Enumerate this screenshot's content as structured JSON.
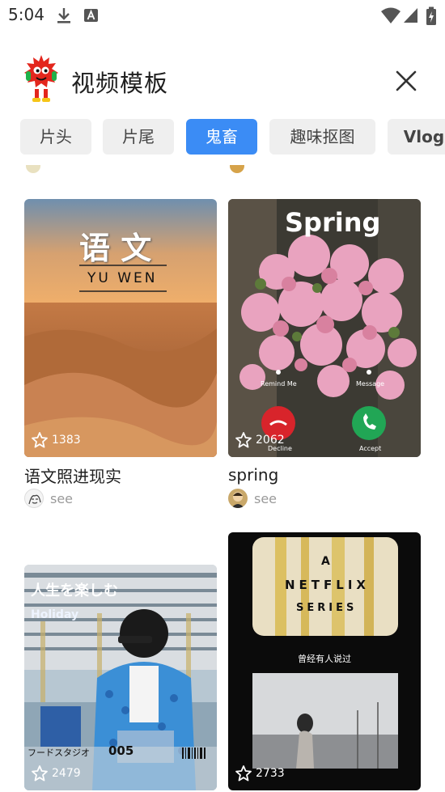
{
  "status_bar": {
    "time": "5:04",
    "icons": [
      "download-icon",
      "a-notification-icon",
      "wifi-icon",
      "signal-icon",
      "battery-charging-icon"
    ]
  },
  "header": {
    "title": "视频模板",
    "close_icon": "close-icon"
  },
  "tabs": [
    {
      "label": "片头",
      "active": false
    },
    {
      "label": "片尾",
      "active": false
    },
    {
      "label": "鬼畜",
      "active": true
    },
    {
      "label": "趣味抠图",
      "active": false
    },
    {
      "label": "Vlog",
      "active": false
    }
  ],
  "colors": {
    "accent": "#3b8cf5",
    "tab_bg": "#efefef",
    "muted": "#9a9a9a"
  },
  "cards": [
    {
      "favorites": "1383",
      "title": "语文照进现实",
      "author": "see",
      "overlay": {
        "big": "语 文",
        "sub": "YU WEN"
      }
    },
    {
      "favorites": "2062",
      "title": "spring",
      "author": "see",
      "overlay": {
        "big": "Spring",
        "left_label": "Remind Me",
        "right_label": "Message",
        "decline": "Decline",
        "accept": "Accept"
      }
    },
    {
      "favorites": "2479",
      "title": "",
      "author": "",
      "overlay": {
        "big": "人生を楽しむ",
        "sub": "Holiday",
        "footer": "フードスタジオ",
        "code": "005"
      }
    },
    {
      "favorites": "2733",
      "title": "",
      "author": "",
      "overlay": {
        "line1": "A",
        "line2": "NETFLIX",
        "line3": "SERIES",
        "caption": "曾经有人说过"
      }
    }
  ]
}
